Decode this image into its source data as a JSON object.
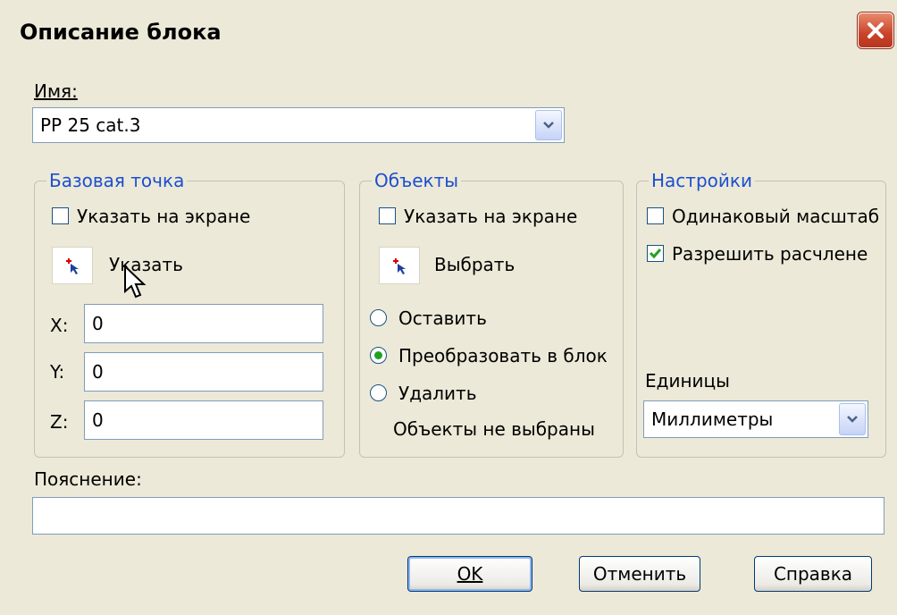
{
  "window": {
    "title": "Описание блока"
  },
  "name": {
    "label": "Имя:",
    "value": "PP 25 cat.3"
  },
  "base_point": {
    "legend": "Базовая точка",
    "specify_on_screen": {
      "label": "Указать на экране",
      "checked": false
    },
    "pick_label": "Указать",
    "x": {
      "label": "X:",
      "value": "0"
    },
    "y": {
      "label": "Y:",
      "value": "0"
    },
    "z": {
      "label": "Z:",
      "value": "0"
    }
  },
  "objects": {
    "legend": "Объекты",
    "specify_on_screen": {
      "label": "Указать на экране",
      "checked": false
    },
    "select_label": "Выбрать",
    "radios": [
      {
        "label": "Оставить",
        "selected": false
      },
      {
        "label": "Преобразовать в блок",
        "selected": true
      },
      {
        "label": "Удалить",
        "selected": false
      }
    ],
    "status": "Объекты не выбраны"
  },
  "settings": {
    "legend": "Настройки",
    "uniform_scale": {
      "label": "Одинаковый масштаб",
      "checked": false
    },
    "allow_explode": {
      "label": "Разрешить расчлене",
      "checked": true
    },
    "units_label": "Единицы",
    "units_value": "Миллиметры"
  },
  "description": {
    "label": "Пояснение:",
    "value": ""
  },
  "buttons": {
    "ok": "OK",
    "cancel": "Отменить",
    "help": "Справка"
  },
  "colors": {
    "accent_legend": "#1c4fcf",
    "dialog_bg": "#ece9d8",
    "close_red": "#c9442a"
  }
}
